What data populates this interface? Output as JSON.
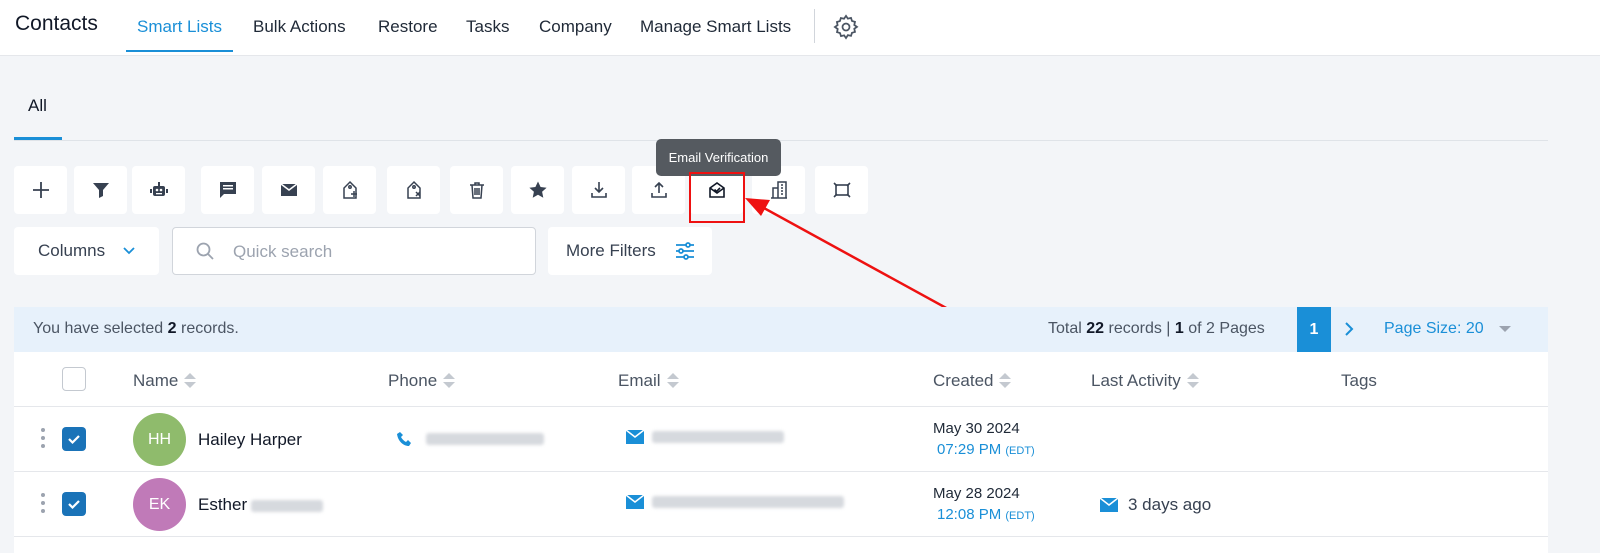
{
  "header": {
    "title": "Contacts",
    "nav": [
      "Smart Lists",
      "Bulk Actions",
      "Restore",
      "Tasks",
      "Company",
      "Manage Smart Lists"
    ]
  },
  "tabs": {
    "active": "All"
  },
  "toolbar": {
    "buttons": [
      "add-icon",
      "filter-icon",
      "robot-icon",
      "message-icon",
      "mail-icon",
      "tag-add-icon",
      "tag-remove-icon",
      "trash-icon",
      "star-icon",
      "download-icon",
      "upload-icon",
      "email-verification-icon",
      "company-icon",
      "merge-icon"
    ],
    "tooltip": "Email Verification"
  },
  "filters": {
    "columns_label": "Columns",
    "search_placeholder": "Quick search",
    "more_filters_label": "More Filters"
  },
  "selection": {
    "prefix": "You have selected",
    "count": "2",
    "suffix": "records."
  },
  "pagination": {
    "total_prefix": "Total",
    "total": "22",
    "records_word": "records |",
    "page": "1",
    "of_pages": "of 2 Pages",
    "current_page": "1",
    "page_size": "Page Size: 20"
  },
  "table": {
    "headers": [
      "Name",
      "Phone",
      "Email",
      "Created",
      "Last Activity",
      "Tags"
    ],
    "rows": [
      {
        "initials": "HH",
        "avatar_color": "#8fbb6c",
        "name": "Hailey Harper",
        "created_date": "May 30 2024",
        "created_time": "07:29 PM",
        "tz": "(EDT)",
        "last_activity": ""
      },
      {
        "initials": "EK",
        "avatar_color": "#c07ab8",
        "name": "Esther",
        "created_date": "May 28 2024",
        "created_time": "12:08 PM",
        "tz": "(EDT)",
        "last_activity": "3 days ago"
      }
    ]
  },
  "colors": {
    "accent": "#1a8fd7",
    "highlight": "#ee1111"
  }
}
